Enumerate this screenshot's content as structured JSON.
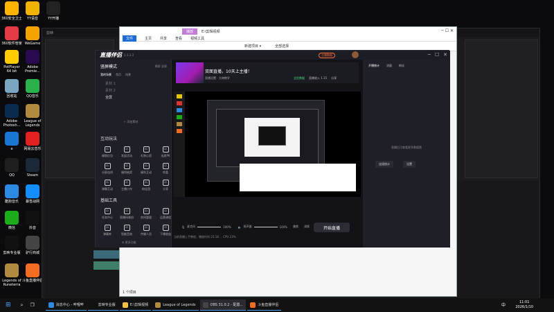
{
  "desktop": {
    "icons": [
      {
        "label": "360安全卫士",
        "icon": "360-icon",
        "color": "#ffb400"
      },
      {
        "label": "YY语音",
        "icon": "yy-icon",
        "color": "#f0b400"
      },
      {
        "label": "YY开播",
        "icon": "yy-live-icon",
        "color": "#222222"
      },
      {
        "label": "360软件管家",
        "icon": "360-manager-icon",
        "color": "#e63946"
      },
      {
        "label": "WeGame",
        "icon": "wegame-icon",
        "color": "#f4a300"
      },
      {
        "label": "PotPlayer 64 bit",
        "icon": "potplayer-icon",
        "color": "#ffcc00"
      },
      {
        "label": "Adobe Premie...",
        "icon": "premiere-icon",
        "color": "#2a0a4f"
      },
      {
        "label": "回收站",
        "icon": "recycle-bin-icon",
        "color": "#7aa6c2"
      },
      {
        "label": "QQ音乐",
        "icon": "qq-music-icon",
        "color": "#29b14a"
      },
      {
        "label": "Adobe Photosh...",
        "icon": "photoshop-icon",
        "color": "#0a2a4f"
      },
      {
        "label": "League of Legends",
        "icon": "lol-icon",
        "color": "#b08a3e"
      },
      {
        "label": "e",
        "icon": "edge-icon",
        "color": "#1976d2"
      },
      {
        "label": "网易云音乐",
        "icon": "netease-music-icon",
        "color": "#e02020"
      },
      {
        "label": "QQ",
        "icon": "qq-icon",
        "color": "#1e1e1e"
      },
      {
        "label": "Steam",
        "icon": "steam-icon",
        "color": "#1b2838"
      },
      {
        "label": "酷狗音乐",
        "icon": "kugou-icon",
        "color": "#2b8ae2"
      },
      {
        "label": "暴雪战网",
        "icon": "battlenet-icon",
        "color": "#148eff"
      },
      {
        "label": "微信",
        "icon": "wechat-icon",
        "color": "#1aad19"
      },
      {
        "label": "抖音",
        "icon": "douyin-icon",
        "color": "#111111"
      },
      {
        "label": "剪映专业版",
        "icon": "capcut-icon",
        "color": "#111111"
      },
      {
        "label": "驴行商城",
        "icon": "shop-icon",
        "color": "#444444"
      },
      {
        "label": "Legends of Runeterra",
        "icon": "runeterra-icon",
        "color": "#b08a3e"
      },
      {
        "label": "斗鱼直播伴侣",
        "icon": "douyu-icon",
        "color": "#f26d21"
      }
    ]
  },
  "editor": {
    "title": "剪映"
  },
  "explorer": {
    "title_tab": "播放",
    "title_path": "E:\\剪辑视频",
    "ribbon_tabs": [
      "文件",
      "主页",
      "共享",
      "查看",
      "视频工具"
    ],
    "toolbar_items": [
      "新建项目 ▾",
      "全部选择"
    ],
    "status": "1 个项目"
  },
  "live": {
    "logo": "直播伴侣",
    "version": "2.3.3.3",
    "header_badge": "主播数据",
    "mode_label": "竖屏模式",
    "mode_options": [
      "横屏",
      "竖屏"
    ],
    "scene_section": "我的场景",
    "scene_tabs": [
      "我的场景",
      "首页",
      "场景"
    ],
    "scenes": [
      "素材 1",
      "素材 2",
      "全屏"
    ],
    "add_source": "添加素材",
    "interactive_title": "互动玩法",
    "interactive_items": [
      "福袋红包",
      "发起活动",
      "礼物心愿",
      "连麦PK",
      "分屏连线",
      "福利抽奖",
      "福利互动",
      "惊喜",
      "弹幕互动",
      "主播口令",
      "粉丝团",
      "分享"
    ],
    "tools_title": "基础工具",
    "tools_items": [
      "任务中心",
      "直播间装扮",
      "房间管理",
      "运营课程",
      "弹幕库",
      "智能音效",
      "传输人员",
      "下播收益"
    ],
    "more": "更多功能",
    "banner_title": "双面直播，10天上主播！",
    "banner_tags": [
      "直播设置",
      "大神教学"
    ],
    "banner_right": [
      "全民数据",
      "直播收入 1.15",
      "分享"
    ],
    "controls": [
      "麦克风",
      "100%",
      "扬声器",
      "100%",
      "美颜",
      "滤镜",
      "设置"
    ],
    "go_live": "开始直播",
    "footer": "当前直播上手教程，播放时间 25:18 ... CPU 23%",
    "right_tabs": [
      "开播统计",
      "流量",
      "粉丝"
    ],
    "right_tip": "直播后可查看更多数据哦",
    "right_buttons": [
      "连接统计",
      "设置"
    ]
  },
  "taskbar": {
    "items": [
      "消息中心 - 哔哩哔",
      "剪映专业版",
      "E:\\剪辑视频",
      "League of Legends",
      "OBS 31.0.2 - 配置...",
      "斗鱼直播伴侣"
    ],
    "time": "11:01",
    "date": "2026/1/10",
    "ime": "中"
  }
}
